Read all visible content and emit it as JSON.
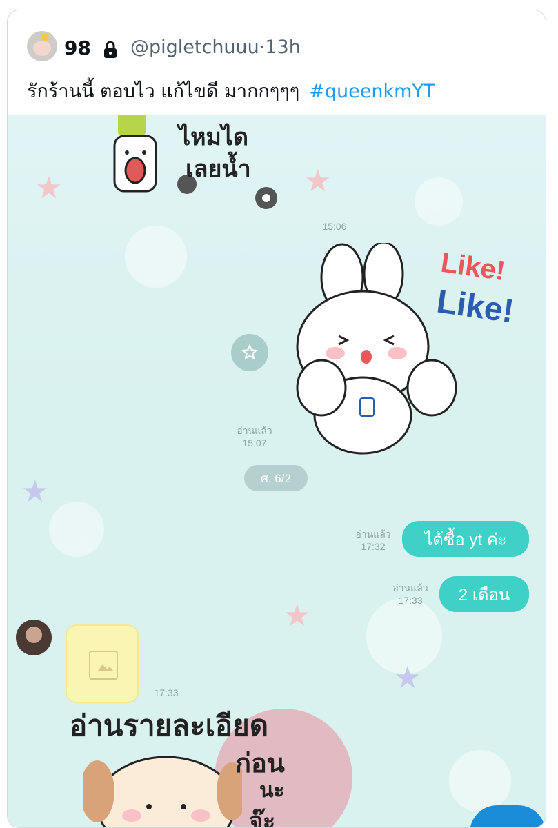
{
  "tweet": {
    "display_name": "98",
    "handle": "@pigletchuuu",
    "separator": "·",
    "time": "13h",
    "text": "รักร้านนี้ ตอบไว แก้ไขดี มากกๆๆๆ",
    "hashtag": "#queenkmYT",
    "hashtag_color": "#1d9bf0"
  },
  "chat": {
    "sticker_top_text_line1": "ไหมได",
    "sticker_top_text_line2": "เลยน้ำ",
    "time_1": "15:06",
    "sticker_like_1": "Like!",
    "sticker_like_2": "Like!",
    "read_label_1": "อ่านแล้ว",
    "time_2": "15:07",
    "date_pill": "ศ. 6/2",
    "msg_1": {
      "read": "อ่านแล้ว",
      "time": "17:32",
      "text": "ได้ซื้อ yt ค่ะ"
    },
    "msg_2": {
      "read": "อ่านแล้ว",
      "time": "17:33",
      "text": "2 เดือน"
    },
    "time_3": "17:33",
    "sticker_bottom_line1": "อ่านรายละเอียด",
    "sticker_bottom_line2": "ก่อน",
    "sticker_bottom_line3": "นะ",
    "sticker_bottom_line4": "จ๊ะ",
    "bubble_color": "#3fd0c7"
  },
  "icons": [
    "lock-icon",
    "star-keep-icon",
    "image-placeholder-icon"
  ]
}
